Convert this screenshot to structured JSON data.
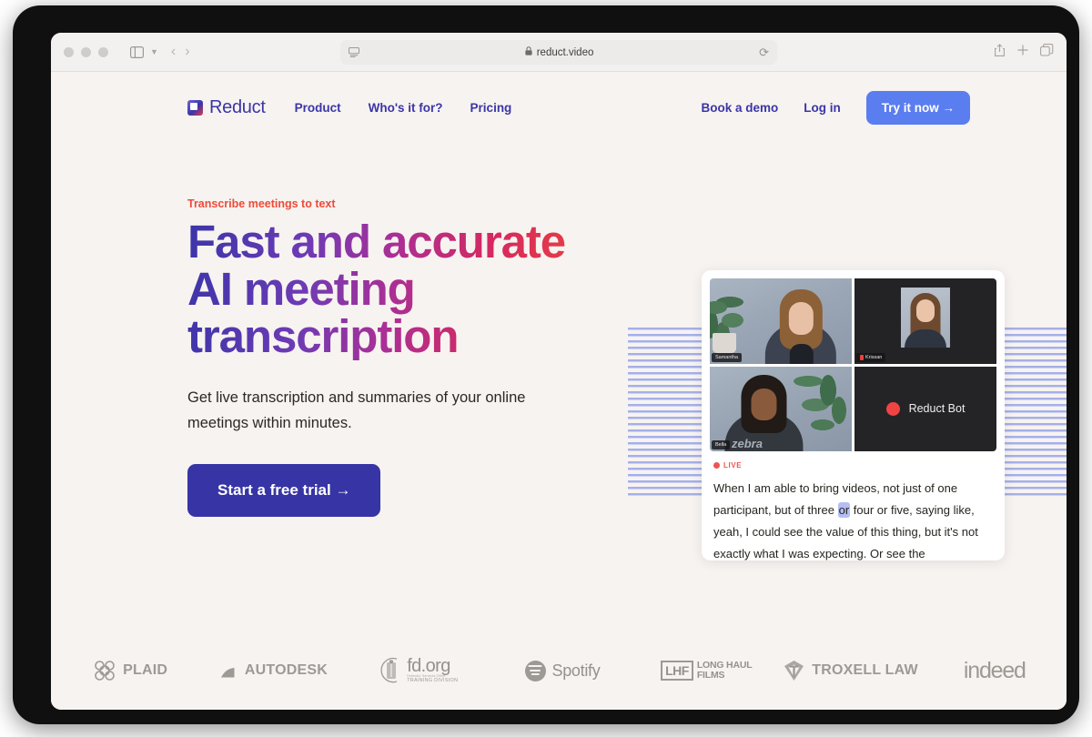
{
  "browser": {
    "url": "reduct.video",
    "lock_icon": "lock-icon",
    "reader_icon": "reader-view-icon",
    "reload_icon": "reload-icon",
    "sidebar_icon": "sidebar-toggle-icon",
    "back_icon": "back-arrow-icon",
    "forward_icon": "forward-arrow-icon",
    "share_icon": "share-icon",
    "new_tab_icon": "plus-icon",
    "tab_overview_icon": "tab-overview-icon",
    "traffic_lights": [
      "close",
      "minimize",
      "zoom"
    ]
  },
  "site": {
    "logo_text": "Reduct",
    "nav_links": [
      {
        "label": "Product"
      },
      {
        "label": "Who's it for?"
      },
      {
        "label": "Pricing"
      }
    ],
    "nav_right": [
      {
        "label": "Book a demo"
      },
      {
        "label": "Log in"
      }
    ],
    "cta_label": "Try it now →"
  },
  "hero": {
    "eyebrow": "Transcribe meetings to text",
    "title": "Fast and accurate AI meeting transcription",
    "subtitle": "Get live transcription and summaries of your online meetings within minutes.",
    "button_label": "Start a free trial →"
  },
  "meeting": {
    "tiles": [
      {
        "name": "Samantha",
        "type": "video",
        "muted": false
      },
      {
        "name": "Krissan",
        "type": "video",
        "muted": true
      },
      {
        "name": "Bella",
        "type": "video",
        "muted": false
      },
      {
        "name": "Reduct Bot",
        "type": "bot",
        "muted": false
      }
    ],
    "live_label": "LIVE",
    "transcript": {
      "part1": "When I am able to bring videos, not just of one participant, but of three ",
      "highlight": "or",
      "part2": " four or five, saying like, yeah, I could see the value of this thing, but it's not exactly what I was expecting. Or see the"
    }
  },
  "logos": [
    {
      "name": "PLAID",
      "icon": "plaid-knot-icon"
    },
    {
      "name": "AUTODESK",
      "icon": "autodesk-arrow-icon"
    },
    {
      "name": "fd.org",
      "sub1": "Defender Services Office",
      "sub2": "TRAINING DIVISION",
      "icon": "fd-org-icon"
    },
    {
      "name": "Spotify",
      "icon": "spotify-icon"
    },
    {
      "name": "LHF",
      "line1": "LONG HAUL",
      "line2": "FILMS",
      "icon": "lhf-icon"
    },
    {
      "name": "TROXELL LAW",
      "icon": "troxell-diamond-icon"
    },
    {
      "name": "indeed",
      "icon": "indeed-icon"
    }
  ],
  "colors": {
    "brand_blue": "#3b35a8",
    "cta_blue": "#5a7df0",
    "accent_red": "#ef4a38",
    "page_bg": "#f7f3f0",
    "live_red": "#ef5350",
    "highlight": "#b4bdf4"
  }
}
